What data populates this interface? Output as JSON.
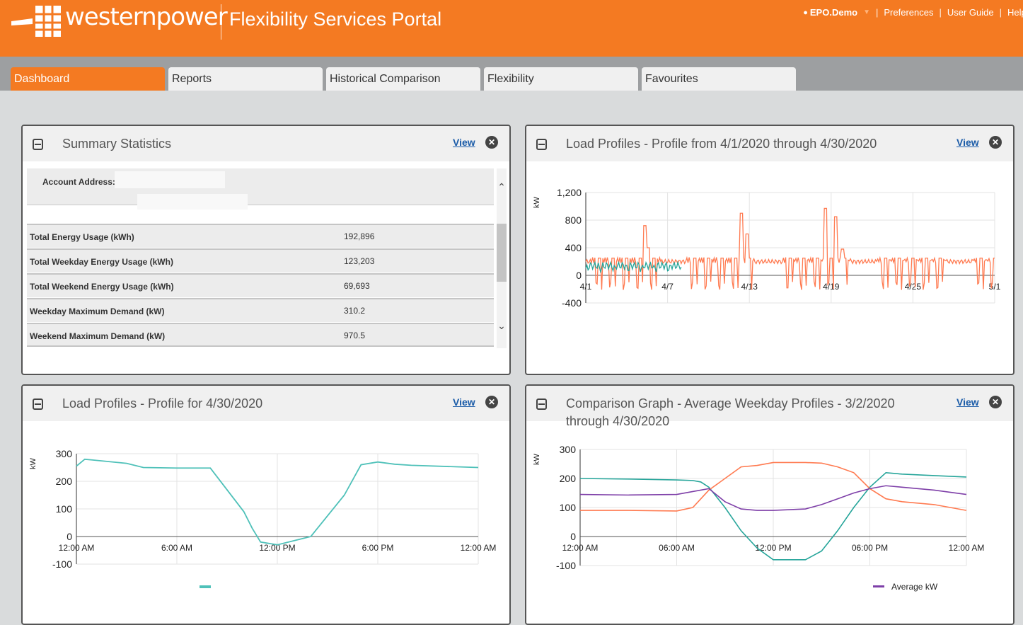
{
  "brand": {
    "name": "westernpower",
    "portal_title": "Flexibility Services Portal"
  },
  "topnav": {
    "user": "EPO.Demo",
    "preferences": "Preferences",
    "user_guide": "User Guide",
    "help": "Help"
  },
  "tabs": [
    {
      "label": "Dashboard",
      "active": true
    },
    {
      "label": "Reports",
      "active": false
    },
    {
      "label": "Historical Comparison",
      "active": false
    },
    {
      "label": "Flexibility",
      "active": false
    },
    {
      "label": "Favourites",
      "active": false
    }
  ],
  "view_label": "View",
  "summary": {
    "title": "Summary Statistics",
    "address_label": "Account Address:",
    "rows": [
      {
        "label": "Total Energy Usage (kWh)",
        "value": "192,896"
      },
      {
        "label": "Total Weekday Energy Usage (kWh)",
        "value": "123,203"
      },
      {
        "label": "Total Weekend Energy Usage (kWh)",
        "value": "69,693"
      },
      {
        "label": "Weekday Maximum Demand (kW)",
        "value": "310.2"
      },
      {
        "label": "Weekend Maximum Demand (kW)",
        "value": "970.5"
      }
    ]
  },
  "chart_data": [
    {
      "type": "line",
      "title": "Load Profiles - Profile from 4/1/2020 through 4/30/2020",
      "ylabel": "kW",
      "ylim": [
        -400,
        1200
      ],
      "yticks": [
        "1,200",
        "800",
        "400",
        "0",
        "-400"
      ],
      "xticks": [
        "4/1",
        "4/7",
        "4/13",
        "4/19",
        "4/25",
        "5/1"
      ],
      "series": [
        {
          "color": "#ff7a50",
          "description": "fluctuating load, daily dips below 0, peaks near 4/5, 4/12, 4/18-4/19 up to ~970"
        },
        {
          "color": "#26a59a",
          "description": "about 100-200 from 4/1 to 4/7"
        }
      ]
    },
    {
      "type": "line",
      "title": "Load Profiles - Profile for 4/30/2020",
      "ylabel": "kW",
      "ylim": [
        -100,
        300
      ],
      "yticks": [
        "300",
        "200",
        "100",
        "0",
        "-100"
      ],
      "xticks": [
        "12:00 AM",
        "6:00 AM",
        "12:00 PM",
        "6:00 PM",
        "12:00 AM"
      ],
      "series": [
        {
          "color": "#4fc1b9",
          "x_hours": [
            0,
            0.5,
            3,
            4,
            6,
            8,
            10,
            10.5,
            11,
            12,
            14,
            16,
            17,
            18,
            19,
            20,
            24
          ],
          "values": [
            255,
            280,
            265,
            250,
            248,
            248,
            90,
            30,
            -20,
            -30,
            0,
            150,
            260,
            270,
            262,
            258,
            250
          ]
        }
      ]
    },
    {
      "type": "line",
      "title": "Comparison Graph - Average Weekday Profiles - 3/2/2020 through 4/30/2020",
      "ylabel": "kW",
      "ylim": [
        -100,
        300
      ],
      "yticks": [
        "300",
        "200",
        "100",
        "0",
        "-100"
      ],
      "xticks": [
        "12:00 AM",
        "06:00 AM",
        "12:00 PM",
        "06:00 PM",
        "12:00 AM"
      ],
      "legend": [
        "Average kW"
      ],
      "series": [
        {
          "color": "#26a59a",
          "x_hours": [
            0,
            3,
            6,
            7,
            7.5,
            8,
            9,
            10,
            11,
            12,
            14,
            15,
            16,
            17,
            18,
            19,
            20,
            22,
            24
          ],
          "values": [
            200,
            198,
            195,
            193,
            188,
            170,
            100,
            20,
            -40,
            -80,
            -80,
            -50,
            20,
            100,
            170,
            220,
            215,
            210,
            205
          ]
        },
        {
          "color": "#ff7a50",
          "x_hours": [
            0,
            3,
            6,
            7,
            8,
            9,
            10,
            11,
            12,
            14,
            15,
            16,
            17,
            18,
            19,
            20,
            22,
            24
          ],
          "values": [
            90,
            90,
            88,
            100,
            160,
            200,
            240,
            245,
            255,
            255,
            253,
            240,
            220,
            165,
            130,
            120,
            110,
            90
          ]
        },
        {
          "name": "Average kW",
          "color": "#7e3fa8",
          "x_hours": [
            0,
            3,
            6,
            7,
            8,
            9,
            10,
            11,
            12,
            14,
            15,
            16,
            17,
            18,
            19,
            20,
            22,
            24
          ],
          "values": [
            145,
            143,
            145,
            155,
            165,
            120,
            95,
            90,
            90,
            95,
            110,
            130,
            150,
            165,
            175,
            170,
            160,
            145
          ]
        }
      ]
    }
  ]
}
